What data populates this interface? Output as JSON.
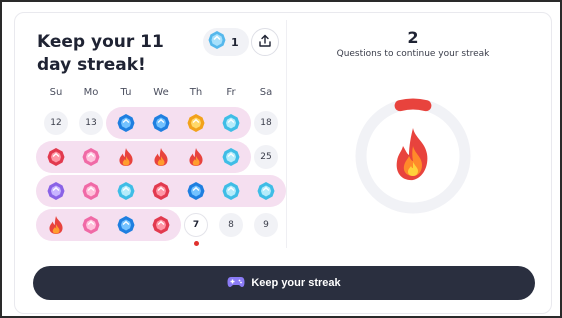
{
  "streak": {
    "title": "Keep your 11 day streak!",
    "gem_count": "1",
    "questions_count": "2",
    "questions_label": "Questions to continue your streak",
    "progress_fraction": 0.08,
    "button_label": "Keep your streak"
  },
  "weekdays": [
    "Su",
    "Mo",
    "Tu",
    "We",
    "Th",
    "Fr",
    "Sa"
  ],
  "calendar_rows": [
    [
      "12",
      "13",
      "gem-blue",
      "gem-blue",
      "gem-gold",
      "gem-cyan",
      "18"
    ],
    [
      "gem-red",
      "gem-pink",
      "flame",
      "flame",
      "flame",
      "gem-cyan",
      "25"
    ],
    [
      "gem-purple",
      "gem-pink",
      "gem-cyan",
      "gem-red",
      "gem-blue",
      "gem-cyan",
      "gem-cyan"
    ],
    [
      "flame",
      "gem-pink",
      "gem-blue",
      "gem-red",
      "today:7",
      "8",
      "9"
    ]
  ],
  "colors": {
    "accent_dark": "#2a2f3f",
    "streak_band": "#f5dff0",
    "progress_red": "#e8433d",
    "ring_track": "#f1f2f6"
  },
  "icons": {
    "share": "share-icon",
    "gem": "gem-icon",
    "flame": "flame-icon",
    "button": "gamepad-icon"
  }
}
